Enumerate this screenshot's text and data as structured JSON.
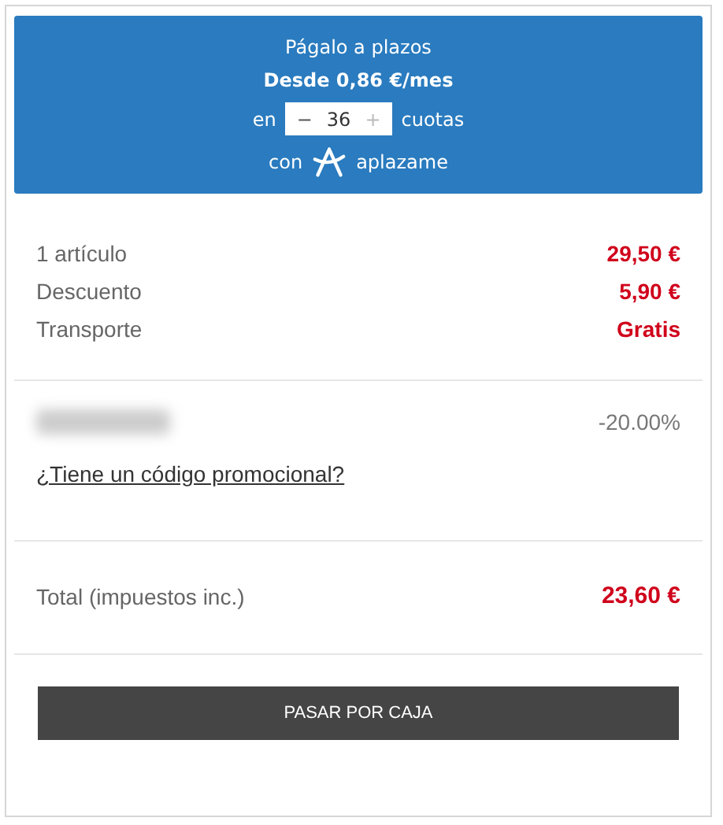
{
  "financing": {
    "title": "Págalo a plazos",
    "from": "Desde 0,86 €/mes",
    "prefix": "en",
    "stepper": {
      "minus": "−",
      "value": "36",
      "plus": "+",
      "minus_disabled": false,
      "plus_disabled": true
    },
    "suffix": "cuotas",
    "with": "con",
    "brand": "aplazame"
  },
  "summary": [
    {
      "label": "1 artículo",
      "value": "29,50 €"
    },
    {
      "label": "Descuento",
      "value": "5,90 €"
    },
    {
      "label": "Transporte",
      "value": "Gratis"
    }
  ],
  "discount": {
    "label": {
      "kind": "blurred"
    },
    "value": "-20.00%"
  },
  "promo_link": "¿Tiene un código promocional?",
  "total": {
    "label": "Total (impuestos inc.)",
    "value": "23,60 €"
  },
  "checkout_button": "PASAR POR CAJA"
}
